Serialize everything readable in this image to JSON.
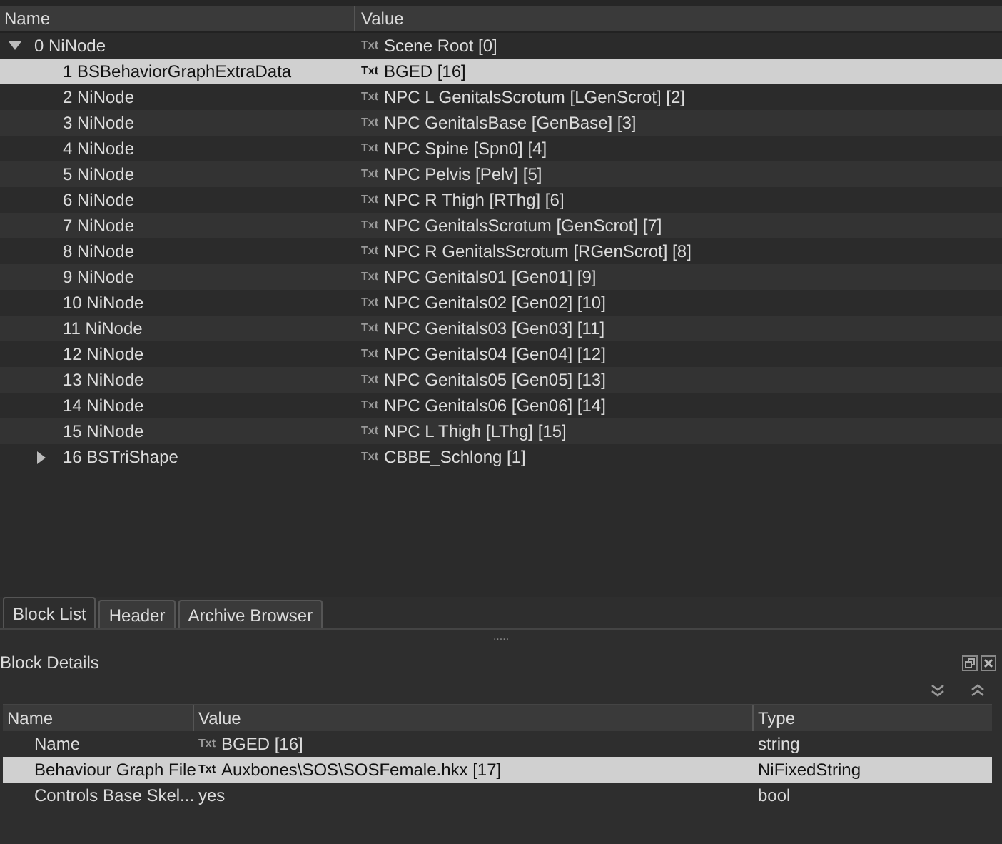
{
  "tree": {
    "columns": [
      "Name",
      "Value"
    ],
    "nodes": [
      {
        "name": "0 NiNode",
        "tag": "Txt",
        "value": "Scene Root [0]",
        "selected": false,
        "expanded": true,
        "children": [
          {
            "name": "1 BSBehaviorGraphExtraData",
            "tag": "Txt",
            "value": "BGED [16]",
            "selected": true
          },
          {
            "name": "2 NiNode",
            "tag": "Txt",
            "value": "NPC L GenitalsScrotum [LGenScrot] [2]",
            "selected": false
          },
          {
            "name": "3 NiNode",
            "tag": "Txt",
            "value": "NPC GenitalsBase [GenBase] [3]",
            "selected": false
          },
          {
            "name": "4 NiNode",
            "tag": "Txt",
            "value": "NPC Spine [Spn0] [4]",
            "selected": false
          },
          {
            "name": "5 NiNode",
            "tag": "Txt",
            "value": "NPC Pelvis [Pelv] [5]",
            "selected": false
          },
          {
            "name": "6 NiNode",
            "tag": "Txt",
            "value": "NPC R Thigh [RThg] [6]",
            "selected": false
          },
          {
            "name": "7 NiNode",
            "tag": "Txt",
            "value": "NPC GenitalsScrotum [GenScrot] [7]",
            "selected": false
          },
          {
            "name": "8 NiNode",
            "tag": "Txt",
            "value": "NPC R GenitalsScrotum [RGenScrot] [8]",
            "selected": false
          },
          {
            "name": "9 NiNode",
            "tag": "Txt",
            "value": "NPC Genitals01 [Gen01] [9]",
            "selected": false
          },
          {
            "name": "10 NiNode",
            "tag": "Txt",
            "value": "NPC Genitals02 [Gen02] [10]",
            "selected": false
          },
          {
            "name": "11 NiNode",
            "tag": "Txt",
            "value": "NPC Genitals03 [Gen03] [11]",
            "selected": false
          },
          {
            "name": "12 NiNode",
            "tag": "Txt",
            "value": "NPC Genitals04 [Gen04] [12]",
            "selected": false
          },
          {
            "name": "13 NiNode",
            "tag": "Txt",
            "value": "NPC Genitals05 [Gen05] [13]",
            "selected": false
          },
          {
            "name": "14 NiNode",
            "tag": "Txt",
            "value": "NPC Genitals06 [Gen06] [14]",
            "selected": false
          },
          {
            "name": "15 NiNode",
            "tag": "Txt",
            "value": "NPC L Thigh [LThg] [15]",
            "selected": false
          },
          {
            "name": "16 BSTriShape",
            "tag": "Txt",
            "value": "CBBE_Schlong [1]",
            "selected": false,
            "expanded": false
          }
        ]
      }
    ]
  },
  "tabs": [
    {
      "label": "Block List",
      "selected": true
    },
    {
      "label": "Header",
      "selected": false
    },
    {
      "label": "Archive Browser",
      "selected": false
    }
  ],
  "splitter": ".....",
  "details": {
    "title": "Block Details",
    "columns": [
      "Name",
      "Value",
      "Type"
    ],
    "rows": [
      {
        "name": "Name",
        "tag": "Txt",
        "value": "BGED [16]",
        "type": "string",
        "selected": false
      },
      {
        "name": "Behaviour Graph File",
        "tag": "Txt",
        "value": "Auxbones\\SOS\\SOSFemale.hkx [17]",
        "type": "NiFixedString",
        "selected": true
      },
      {
        "name": "Controls Base Skel...",
        "value": "yes",
        "type": "bool",
        "selected": false
      }
    ]
  }
}
